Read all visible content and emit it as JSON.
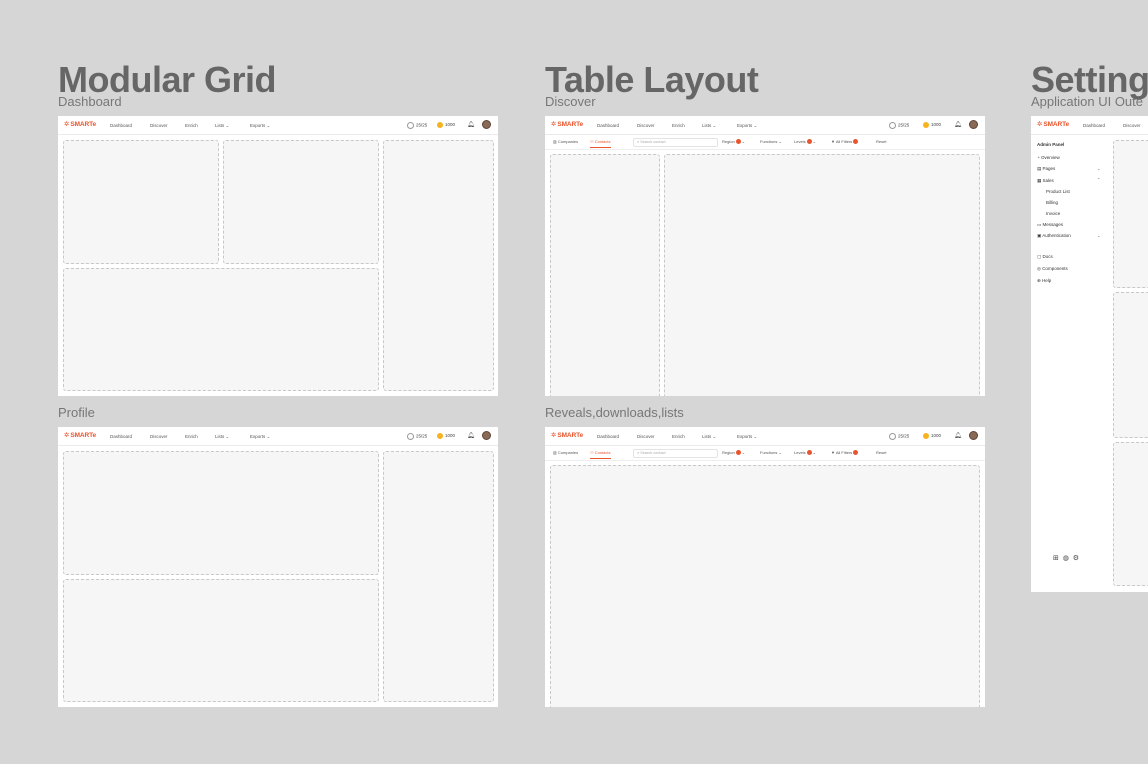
{
  "sections": {
    "modular": {
      "title": "Modular Grid",
      "subtitle": "Dashboard",
      "second_label": "Profile"
    },
    "table": {
      "title": "Table Layout",
      "subtitle": "Discover",
      "second_label": "Reveals,downloads,lists"
    },
    "settings": {
      "title": "Setting",
      "subtitle": "Application UI Oute"
    }
  },
  "topbar": {
    "logo": "SMARTe",
    "nav": [
      "Dashboard",
      "Discover",
      "Enrich",
      "Lists ⌄",
      "Exports ⌄"
    ],
    "credits_left": "25/25",
    "credits_right": "1000"
  },
  "subbar": {
    "tabs": [
      "Companies",
      "Contacts"
    ],
    "search_placeholder": "Search contact",
    "filters": [
      "Region",
      "Functions ⌄",
      "Levels",
      "All Filters",
      "Reset"
    ]
  },
  "settings_sidebar": {
    "heading": "Admin Panel",
    "items": [
      "Overview",
      "Pages",
      "Sales",
      "Product List",
      "Billing",
      "Invoice",
      "Messages",
      "Authentication",
      "Docs",
      "Components",
      "Help"
    ],
    "nav_partial": [
      "Dashboard",
      "Discover"
    ]
  },
  "colors": {
    "brand": "#e8542c",
    "coin": "#f6b31d",
    "background": "#d6d6d6"
  }
}
